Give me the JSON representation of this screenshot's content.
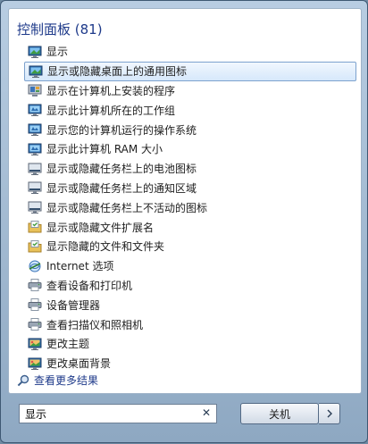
{
  "section": {
    "title": "控制面板 (81)"
  },
  "items": [
    {
      "label": "显示",
      "icon": "display-icon"
    },
    {
      "label": "显示或隐藏桌面上的通用图标",
      "icon": "display-icon"
    },
    {
      "label": "显示在计算机上安装的程序",
      "icon": "programs-icon"
    },
    {
      "label": "显示此计算机所在的工作组",
      "icon": "system-icon"
    },
    {
      "label": "显示您的计算机运行的操作系统",
      "icon": "system-icon"
    },
    {
      "label": "显示此计算机 RAM 大小",
      "icon": "system-icon"
    },
    {
      "label": "显示或隐藏任务栏上的电池图标",
      "icon": "taskbar-icon"
    },
    {
      "label": "显示或隐藏任务栏上的通知区域",
      "icon": "taskbar-icon"
    },
    {
      "label": "显示或隐藏任务栏上不活动的图标",
      "icon": "taskbar-icon"
    },
    {
      "label": "显示或隐藏文件扩展名",
      "icon": "folder-options-icon"
    },
    {
      "label": "显示隐藏的文件和文件夹",
      "icon": "folder-options-icon"
    },
    {
      "label": "Internet 选项",
      "icon": "internet-options-icon"
    },
    {
      "label": "查看设备和打印机",
      "icon": "printer-icon"
    },
    {
      "label": "设备管理器",
      "icon": "printer-icon"
    },
    {
      "label": "查看扫描仪和照相机",
      "icon": "printer-icon"
    },
    {
      "label": "更改主题",
      "icon": "personalization-icon"
    },
    {
      "label": "更改桌面背景",
      "icon": "personalization-icon"
    }
  ],
  "selected_index": 1,
  "more": {
    "label": "查看更多结果"
  },
  "search": {
    "value": "显示"
  },
  "shutdown": {
    "label": "关机"
  },
  "colors": {
    "link": "#1e3a8a",
    "selection_border": "#7da2ce",
    "frame": "#8ea8c2"
  }
}
